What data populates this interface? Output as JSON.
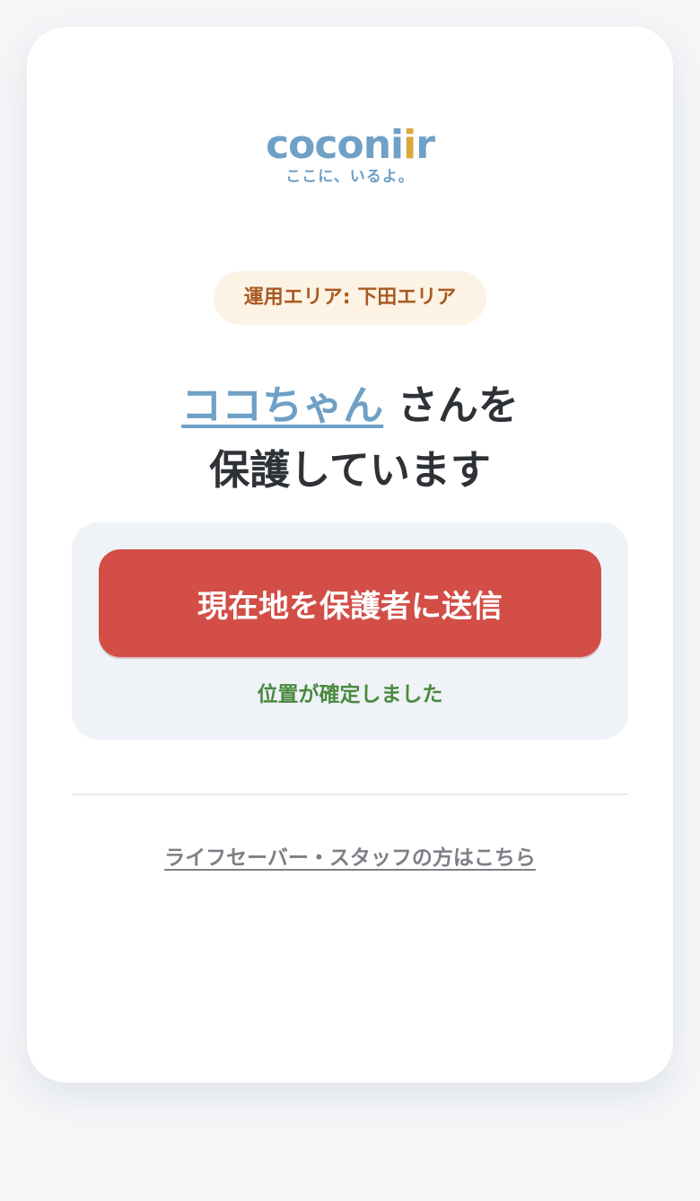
{
  "logo": {
    "word_main": "coconi",
    "word_accent": "i",
    "word_end": "r",
    "tagline": "ここに、いるよ。"
  },
  "badge": {
    "area_label": "運用エリア: 下田エリア"
  },
  "headline": {
    "child_name": "ココちゃん",
    "suffix": " さんを",
    "line2": "保護しています"
  },
  "action": {
    "send_button_label": "現在地を保護者に送信",
    "status": "位置が確定しました"
  },
  "footer": {
    "staff_link": "ライフセーバー・スタッフの方はこちら"
  },
  "colors": {
    "brand_blue": "#6fa0c6",
    "brand_gold": "#d8a83a",
    "send_red": "#d24e47",
    "status_green": "#4a8a40",
    "badge_bg": "#fcf3e4",
    "badge_text": "#a85a22"
  }
}
